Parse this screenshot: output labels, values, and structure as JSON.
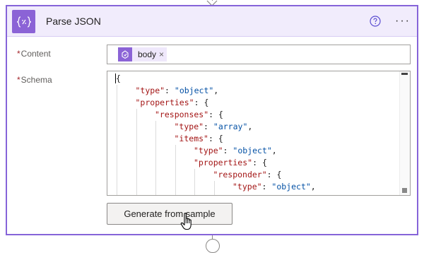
{
  "card": {
    "title": "Parse JSON",
    "more_label": "···",
    "help_icon": "question-circle-icon",
    "action_icon": "curly-braces-data-operation-icon",
    "accent_color": "#8b63d6",
    "header_color": "#f1ecfc"
  },
  "fields": {
    "content": {
      "required_mark": "*",
      "label": "Content",
      "token": {
        "label": "body",
        "remove_glyph": "×",
        "icon": "http-trigger-icon"
      }
    },
    "schema": {
      "required_mark": "*",
      "label": "Schema",
      "lines": [
        {
          "indent": 0,
          "parts": [
            [
              "p",
              "{"
            ]
          ]
        },
        {
          "indent": 1,
          "parts": [
            [
              "k",
              "\"type\""
            ],
            [
              "p",
              ": "
            ],
            [
              "s",
              "\"object\""
            ],
            [
              "p",
              ","
            ]
          ]
        },
        {
          "indent": 1,
          "parts": [
            [
              "k",
              "\"properties\""
            ],
            [
              "p",
              ": {"
            ]
          ]
        },
        {
          "indent": 2,
          "parts": [
            [
              "k",
              "\"responses\""
            ],
            [
              "p",
              ": {"
            ]
          ]
        },
        {
          "indent": 3,
          "parts": [
            [
              "k",
              "\"type\""
            ],
            [
              "p",
              ": "
            ],
            [
              "s",
              "\"array\""
            ],
            [
              "p",
              ","
            ]
          ]
        },
        {
          "indent": 3,
          "parts": [
            [
              "k",
              "\"items\""
            ],
            [
              "p",
              ": {"
            ]
          ]
        },
        {
          "indent": 4,
          "parts": [
            [
              "k",
              "\"type\""
            ],
            [
              "p",
              ": "
            ],
            [
              "s",
              "\"object\""
            ],
            [
              "p",
              ","
            ]
          ]
        },
        {
          "indent": 4,
          "parts": [
            [
              "k",
              "\"properties\""
            ],
            [
              "p",
              ": {"
            ]
          ]
        },
        {
          "indent": 5,
          "parts": [
            [
              "k",
              "\"responder\""
            ],
            [
              "p",
              ": {"
            ]
          ]
        },
        {
          "indent": 6,
          "parts": [
            [
              "k",
              "\"type\""
            ],
            [
              "p",
              ": "
            ],
            [
              "s",
              "\"object\""
            ],
            [
              "p",
              ","
            ]
          ]
        }
      ]
    }
  },
  "generate_button": {
    "label": "Generate from sample"
  }
}
